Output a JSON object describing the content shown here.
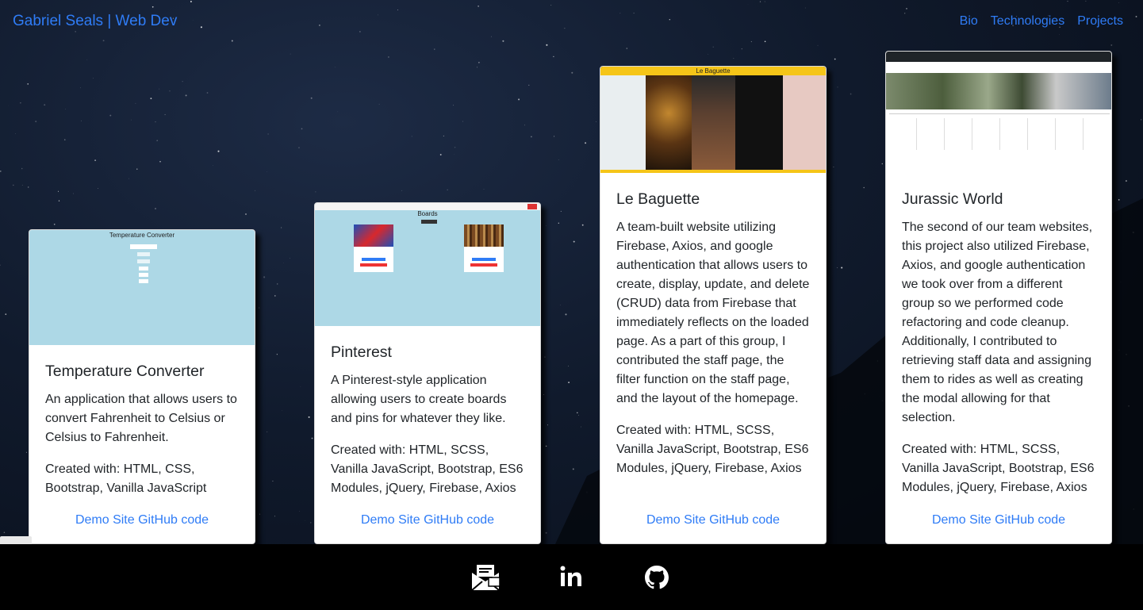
{
  "nav": {
    "brand": "Gabriel Seals | Web Dev",
    "links": [
      "Bio",
      "Technologies",
      "Projects"
    ]
  },
  "projects": [
    {
      "title": "Temperature Converter",
      "description": "An application that allows users to convert Fahrenheit to Celsius or Celsius to Fahrenheit.",
      "created_with": "Created with: HTML, CSS, Bootstrap, Vanilla JavaScript",
      "demo_label": "Demo Site",
      "github_label": "GitHub code",
      "thumb_title": "Temperature Converter"
    },
    {
      "title": "Pinterest",
      "description": "A Pinterest-style application allowing users to create boards and pins for whatever they like.",
      "created_with": "Created with: HTML, SCSS, Vanilla JavaScript, Bootstrap, ES6 Modules, jQuery, Firebase, Axios",
      "demo_label": "Demo Site",
      "github_label": "GitHub code",
      "thumb_title": "Boards"
    },
    {
      "title": "Le Baguette",
      "description": "A team-built website utilizing Firebase, Axios, and google authentication that allows users to create, display, update, and delete (CRUD) data from Firebase that immediately reflects on the loaded page. As a part of this group, I contributed the staff page, the filter function on the staff page, and the layout of the homepage.",
      "created_with": "Created with: HTML, SCSS, Vanilla JavaScript, Bootstrap, ES6 Modules, jQuery, Firebase, Axios",
      "demo_label": "Demo Site",
      "github_label": "GitHub code",
      "thumb_title": "Le Baguette"
    },
    {
      "title": "Jurassic World",
      "description": "The second of our team websites, this project also utilized Firebase, Axios, and google authentication we took over from a different group so we performed code refactoring and code cleanup. Additionally, I contributed to retrieving staff data and assigning them to rides as well as creating the modal allowing for that selection.",
      "created_with": "Created with: HTML, SCSS, Vanilla JavaScript, Bootstrap, ES6 Modules, jQuery, Firebase, Axios",
      "demo_label": "Demo Site",
      "github_label": "GitHub code",
      "thumb_title": ""
    }
  ],
  "footer": {
    "icons": [
      "email-icon",
      "linkedin-icon",
      "github-icon"
    ]
  },
  "colors": {
    "link": "#2f7cf6",
    "footer_bg": "#000000",
    "thumb_lightblue": "#add8e6",
    "baguette_yellow": "#f5c518"
  }
}
